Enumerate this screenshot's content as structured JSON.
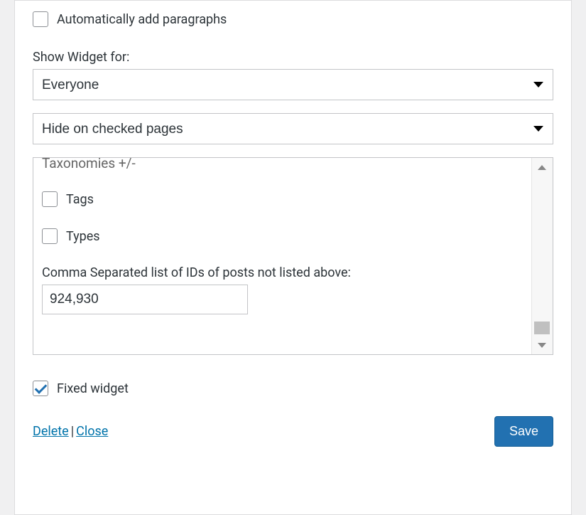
{
  "widget": {
    "auto_paragraphs": {
      "label": "Automatically add paragraphs",
      "checked": false
    },
    "show_for": {
      "label": "Show Widget for:",
      "selected": "Everyone"
    },
    "visibility_mode": {
      "selected": "Hide on checked pages"
    },
    "taxonomies": {
      "heading": "Taxonomies +/-",
      "tags": {
        "label": "Tags",
        "checked": false
      },
      "types": {
        "label": "Types",
        "checked": false
      },
      "ids_label": "Comma Separated list of IDs of posts not listed above:",
      "ids_value": "924,930"
    },
    "fixed_widget": {
      "label": "Fixed widget",
      "checked": true
    },
    "actions": {
      "delete": "Delete",
      "close": "Close",
      "save": "Save"
    }
  }
}
